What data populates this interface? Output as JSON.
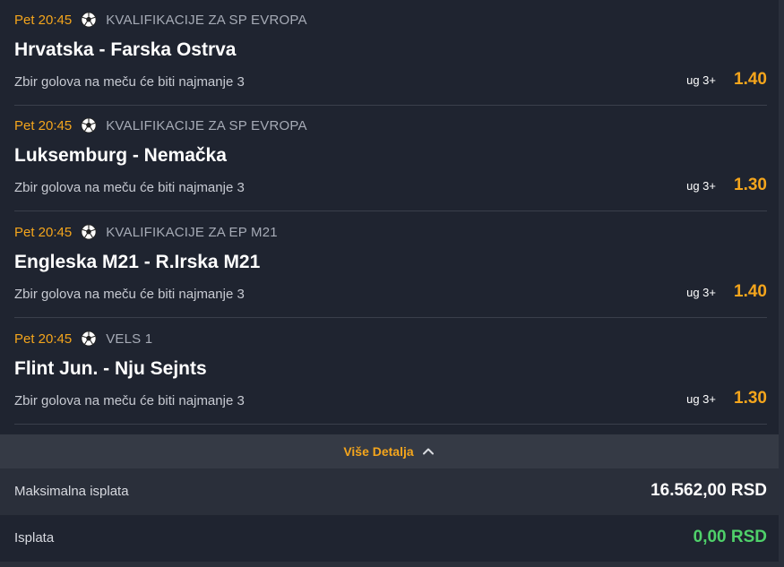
{
  "matches": [
    {
      "time": "Pet 20:45",
      "sport_icon": "soccer-ball-icon",
      "competition": "KVALIFIKACIJE ZA SP EVROPA",
      "teams": "Hrvatska - Farska Ostrva",
      "market": "Zbir golova na meču će biti najmanje 3",
      "selection": "ug 3+",
      "odd": "1.40"
    },
    {
      "time": "Pet 20:45",
      "sport_icon": "soccer-ball-icon",
      "competition": "KVALIFIKACIJE ZA SP EVROPA",
      "teams": "Luksemburg - Nemačka",
      "market": "Zbir golova na meču će biti najmanje 3",
      "selection": "ug 3+",
      "odd": "1.30"
    },
    {
      "time": "Pet 20:45",
      "sport_icon": "soccer-ball-icon",
      "competition": "KVALIFIKACIJE ZA EP M21",
      "teams": "Engleska M21 - R.Irska M21",
      "market": "Zbir golova na meču će biti najmanje 3",
      "selection": "ug 3+",
      "odd": "1.40"
    },
    {
      "time": "Pet 20:45",
      "sport_icon": "soccer-ball-icon",
      "competition": "VELS 1",
      "teams": "Flint Jun. - Nju Sejnts",
      "market": "Zbir golova na meču će biti najmanje 3",
      "selection": "ug 3+",
      "odd": "1.30"
    }
  ],
  "details": {
    "label": "Više Detalja",
    "icon": "chevron-up-icon"
  },
  "summary": {
    "max_payout_label": "Maksimalna isplata",
    "max_payout_value": "16.562,00 RSD",
    "payout_label": "Isplata",
    "payout_value": "0,00 RSD"
  },
  "colors": {
    "accent": "#f4a51c",
    "positive": "#4fd16a",
    "background": "#1f2430"
  }
}
